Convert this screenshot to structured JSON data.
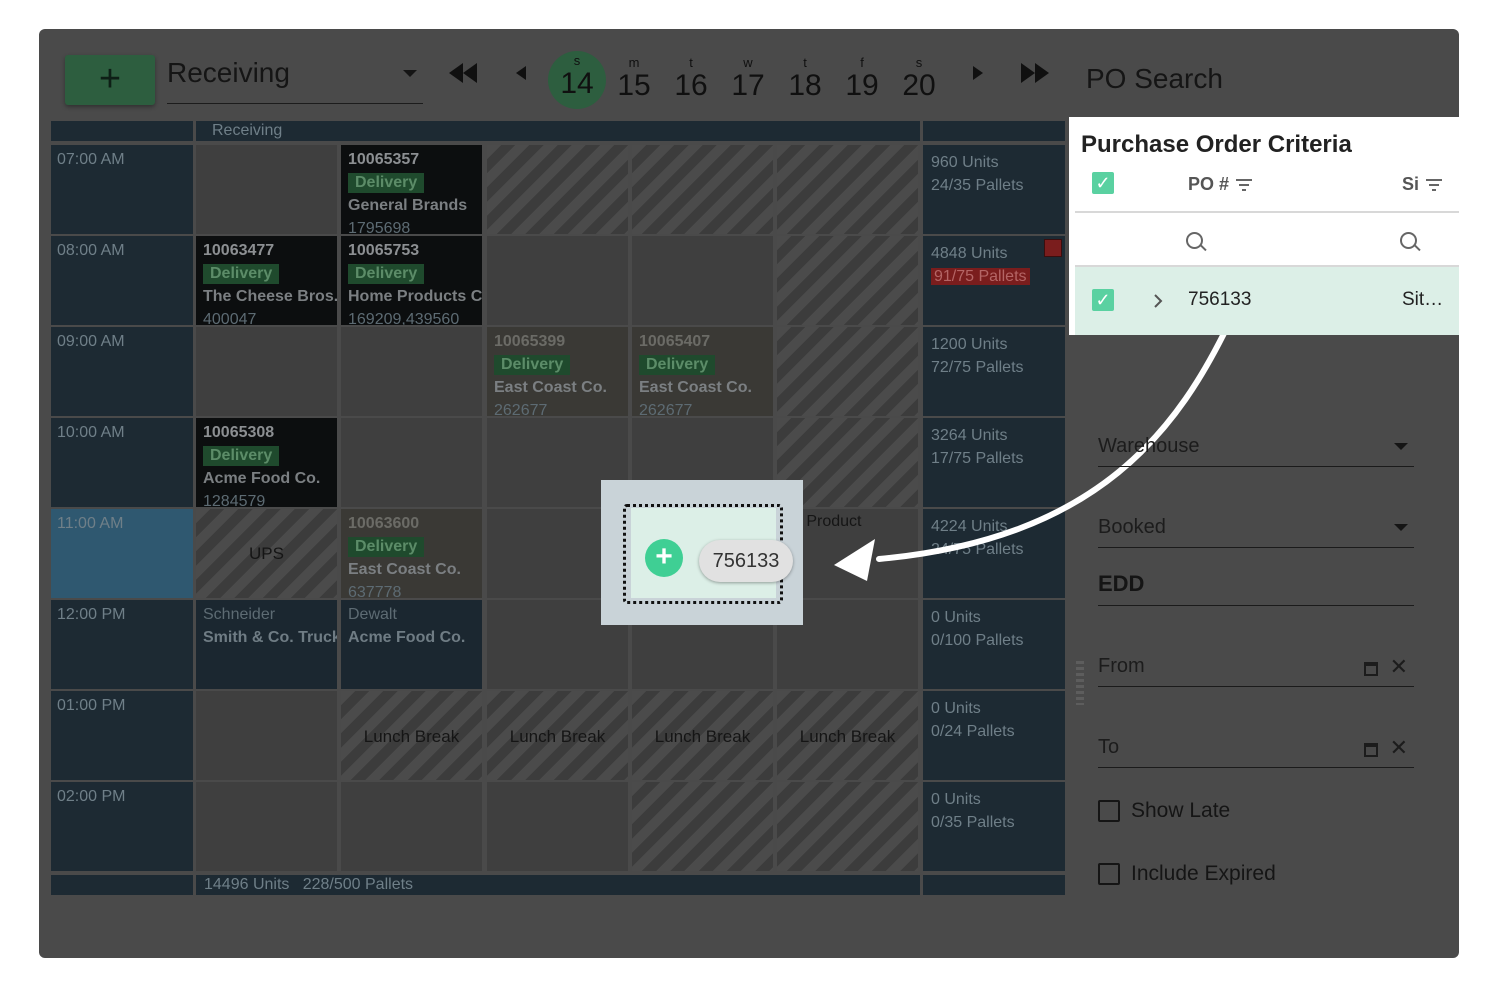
{
  "toolbar": {
    "add_label": "+",
    "department": "Receiving",
    "nav": {
      "first": "◀◀",
      "prev": "◀",
      "next": "▶",
      "last": "▶▶"
    },
    "days": [
      {
        "letter": "s",
        "num": "14",
        "selected": true
      },
      {
        "letter": "m",
        "num": "15"
      },
      {
        "letter": "t",
        "num": "16"
      },
      {
        "letter": "w",
        "num": "17"
      },
      {
        "letter": "t",
        "num": "18"
      },
      {
        "letter": "f",
        "num": "19"
      },
      {
        "letter": "s",
        "num": "20"
      }
    ]
  },
  "schedule": {
    "header_label": "Receiving",
    "times": [
      "07:00 AM",
      "08:00 AM",
      "09:00 AM",
      "10:00 AM",
      "11:00 AM",
      "12:00 PM",
      "01:00 PM",
      "02:00 PM"
    ],
    "summaries": [
      {
        "units": "960 Units",
        "pallets": "24/35 Pallets"
      },
      {
        "units": "4848 Units",
        "pallets": "91/75 Pallets",
        "over": true
      },
      {
        "units": "1200 Units",
        "pallets": "72/75 Pallets"
      },
      {
        "units": "3264 Units",
        "pallets": "17/75 Pallets"
      },
      {
        "units": "4224 Units",
        "pallets": "24/75 Pallets"
      },
      {
        "units": "0 Units",
        "pallets": "0/100 Pallets"
      },
      {
        "units": "0 Units",
        "pallets": "0/24 Pallets"
      },
      {
        "units": "0 Units",
        "pallets": "0/35 Pallets"
      }
    ],
    "appointments": [
      {
        "po": "10065357",
        "tag": "Delivery",
        "vendor": "General Brands",
        "num": "1795698"
      },
      {
        "po": "10063477",
        "tag": "Delivery",
        "vendor": "The Cheese Bros.",
        "num": "400047"
      },
      {
        "po": "10065753",
        "tag": "Delivery",
        "vendor": "Home Products Co.",
        "num": "169209,439560"
      },
      {
        "po": "10065399",
        "tag": "Delivery",
        "vendor": "East Coast Co.",
        "num": "262677"
      },
      {
        "po": "10065407",
        "tag": "Delivery",
        "vendor": "East Coast Co.",
        "num": "262677"
      },
      {
        "po": "10065308",
        "tag": "Delivery",
        "vendor": "Acme Food Co.",
        "num": "1284579"
      },
      {
        "po": "10063600",
        "tag": "Delivery",
        "vendor": "East Coast Co.",
        "num": "637778"
      },
      {
        "line1": "Schneider",
        "line2": "Smith & Co. Truck"
      },
      {
        "line1": "Dewalt",
        "line2": "Acme Food Co."
      }
    ],
    "ups_label": "UPS",
    "hot_product": "Hot Product",
    "lunch_label": "Lunch Break",
    "footer": "14496 Units   228/500 Pallets"
  },
  "drag": {
    "po": "756133"
  },
  "panel": {
    "title": "PO Search",
    "criteria": {
      "title": "Purchase Order Criteria",
      "col_po": "PO #",
      "col_site": "Si",
      "row_po": "756133",
      "row_site": "Sit…"
    },
    "warehouse": "Warehouse",
    "status": "Booked",
    "edd": "EDD",
    "from": "From",
    "to": "To",
    "show_late": "Show Late",
    "include_expired": "Include Expired"
  },
  "colors": {
    "accent": "#5ad1a1",
    "dark_green": "#2d5e3f",
    "overlay": "#4a4a4a",
    "warning": "#7a1d1d"
  }
}
